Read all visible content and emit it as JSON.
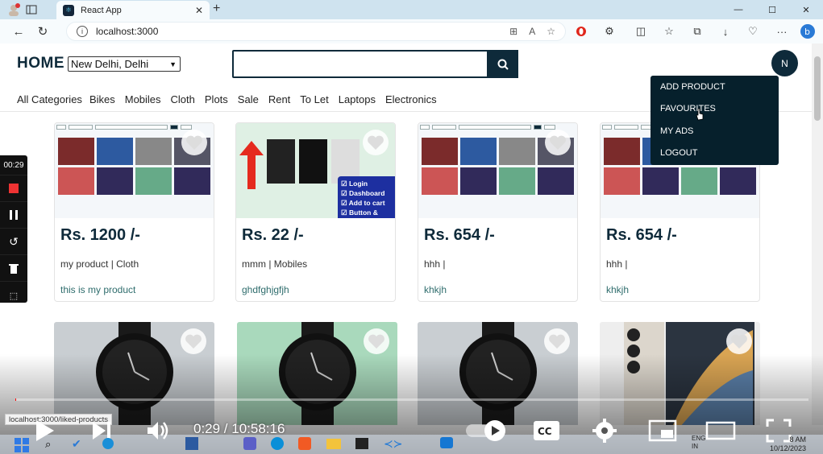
{
  "browser": {
    "tab_title": "React App",
    "url": "localhost:3000",
    "status_url": "localhost:3000/liked-products"
  },
  "header": {
    "brand": "HOME",
    "location": "New Delhi, Delhi",
    "search_placeholder": "",
    "avatar_initial": "N"
  },
  "categories": [
    "All Categories",
    "Bikes",
    "Mobiles",
    "Cloth",
    "Plots",
    "Sale",
    "Rent",
    "To Let",
    "Laptops",
    "Electronics"
  ],
  "user_menu": [
    "ADD PRODUCT",
    "FAVOURITES",
    "MY ADS",
    "LOGOUT"
  ],
  "products": [
    {
      "price": "Rs. 1200 /-",
      "title": "my product | Cloth",
      "desc": "this is my product"
    },
    {
      "price": "Rs. 22 /-",
      "title": "mmm | Mobiles",
      "desc": "ghdfghjgfjh",
      "overlay": [
        "Login",
        "Dashboard",
        "Add to cart",
        "Button & Page"
      ]
    },
    {
      "price": "Rs. 654 /-",
      "title": "hhh |",
      "desc": "khkjh"
    },
    {
      "price": "Rs. 654 /-",
      "title": "hhh |",
      "desc": "khkjh"
    }
  ],
  "recorder": {
    "time": "00:29"
  },
  "video": {
    "time": "0:29 / 10:58:16",
    "progress": 0.0007
  },
  "taskbar": {
    "lang1": "ENG",
    "lang2": "IN",
    "clock_time": "8 AM",
    "clock_date": "10/12/2023"
  },
  "colors": {
    "primary": "#0e2a3a",
    "menu_bg": "#06202c",
    "accent_red": "#ff0000"
  }
}
